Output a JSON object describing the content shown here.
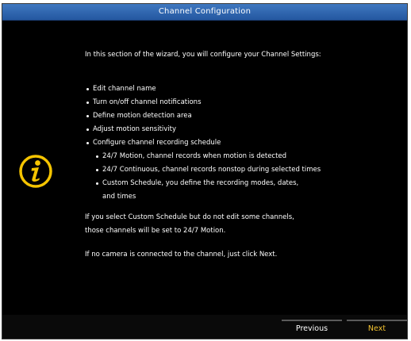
{
  "window": {
    "title": "Channel Configuration"
  },
  "main": {
    "intro": "In this section of the wizard, you will configure your Channel Settings:",
    "bullets": [
      "Edit channel name",
      "Turn on/off channel notifications",
      "Define motion detection area",
      "Adjust motion sensitivity",
      "Configure channel recording schedule"
    ],
    "sub_bullets": [
      "24/7 Motion, channel records when motion is detected",
      "24/7 Continuous, channel records nonstop during selected times",
      "Custom Schedule, you define the recording modes, dates,"
    ],
    "sub_continuation": "and times",
    "note1_line1": "If you select Custom Schedule but do not edit some channels,",
    "note1_line2": "those channels will be set to 24/7 Motion.",
    "note2": "If no camera is connected to the channel, just click Next."
  },
  "icons": {
    "info": "info-icon"
  },
  "footer": {
    "previous_label": "Previous",
    "next_label": "Next"
  },
  "colors": {
    "title_bar": "#2f68b3",
    "next_accent": "#f2c230",
    "icon_yellow": "#f5c400"
  }
}
